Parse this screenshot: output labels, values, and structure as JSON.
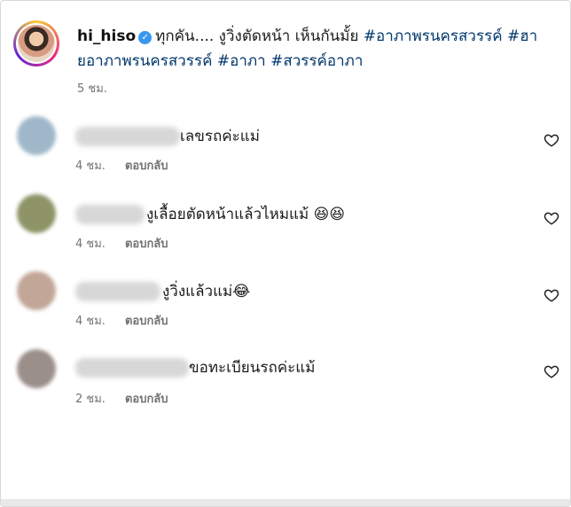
{
  "post": {
    "username": "hi_hiso",
    "caption": "ทุกคัน.... งูวิ่งตัดหน้า เห็นกันมั้ย",
    "hashtags": [
      "#อาภาพรนครสวรรค์",
      "#ฮายอาภาพรนครสวรรค์",
      "#อาภา",
      "#สวรรค์อาภา"
    ],
    "time": "5 ชม."
  },
  "reply_label": "ตอบกลับ",
  "comments": [
    {
      "text": "เลขรถค่ะแม่",
      "time": "4 ชม.",
      "avatar_color": "#9fb8c9"
    },
    {
      "text": "งูเลื้อยตัดหน้าแล้วไหมแม้",
      "emoji": "😆😆",
      "time": "4 ชม.",
      "avatar_color": "#8e9467"
    },
    {
      "text": "งูวิ่งแล้วแม่",
      "emoji": "😂",
      "time": "4 ชม.",
      "avatar_color": "#c2a698"
    },
    {
      "text": "ขอทะเบียนรถค่ะแม้",
      "time": "2 ชม.",
      "avatar_color": "#9b8f8a"
    }
  ],
  "icons": {
    "verified": "verified-badge-icon",
    "like": "heart-outline-icon"
  },
  "colors": {
    "hashtag": "#00376b",
    "meta": "#737373",
    "verified": "#3897f0"
  }
}
